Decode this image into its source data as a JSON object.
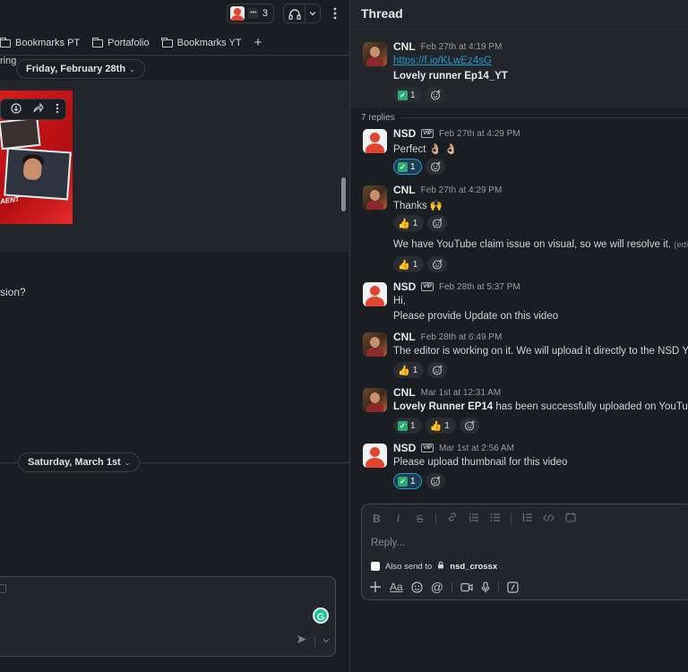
{
  "channel": {
    "member_count": "3",
    "bookmarks": [
      {
        "label": "Bookmarks PT"
      },
      {
        "label": "Portafolio"
      },
      {
        "label": "Bookmarks YT"
      }
    ],
    "partial_text_top": "ring",
    "date_divider_1": "Friday, February 28th",
    "partial_text_mid": "sion?",
    "date_divider_2": "Saturday, March 1st",
    "image_text": "AENT"
  },
  "thread": {
    "title": "Thread",
    "replies_label": "7 replies",
    "parent": {
      "author": "CNL",
      "time": "Feb 27th at 4:19 PM",
      "link": "https://f.io/KLwEz4sG",
      "text": "Lovely runner Ep14_YT",
      "reactions": [
        {
          "emoji": "check",
          "count": "1",
          "mine": false
        }
      ]
    },
    "messages": [
      {
        "author": "NSD",
        "vip": true,
        "time": "Feb 27th at 4:29 PM",
        "text": "Perfect 👌🏼 👌🏼",
        "reactions": [
          {
            "emoji": "check",
            "count": "1",
            "mine": true
          }
        ]
      },
      {
        "author": "CNL",
        "vip": false,
        "time": "Feb 27th at 4:29 PM",
        "text": "Thanks 🙌",
        "reactions": [
          {
            "emoji": "thumbs",
            "count": "1",
            "mine": false
          }
        ]
      },
      {
        "author": "",
        "vip": false,
        "time": "",
        "text": "We have YouTube claim issue on visual, so we will resolve it.",
        "edited": "(edited)",
        "reactions": [
          {
            "emoji": "thumbs",
            "count": "1",
            "mine": false
          }
        ]
      },
      {
        "author": "NSD",
        "vip": true,
        "time": "Feb 28th at 5:37 PM",
        "text": "Hi,",
        "text2": "Please provide Update on this video",
        "reactions": []
      },
      {
        "author": "CNL",
        "vip": false,
        "time": "Feb 28th at 6:49 PM",
        "text": "The editor is working on it. We will upload it directly to the NSD You",
        "reactions": [
          {
            "emoji": "thumbs",
            "count": "1",
            "mine": false
          }
        ]
      },
      {
        "author": "CNL",
        "vip": false,
        "time": "Mar 1st at 12:31 AM",
        "bold": "Lovely Runner EP14",
        "text": " has been successfully uploaded on YouTube as",
        "reactions": [
          {
            "emoji": "check",
            "count": "1",
            "mine": false
          },
          {
            "emoji": "thumbs",
            "count": "1",
            "mine": false
          }
        ]
      },
      {
        "author": "NSD",
        "vip": true,
        "time": "Mar 1st at 2:56 AM",
        "text": "Please upload thumbnail for this video",
        "reactions": [
          {
            "emoji": "check",
            "count": "1",
            "mine": true
          }
        ]
      }
    ],
    "composer": {
      "placeholder": "Reply...",
      "also_send": "Also send to",
      "channel": "nsd_crossx"
    }
  },
  "icons": {
    "vip_badge": "VIP",
    "thumbs": "👍",
    "check": "✓"
  }
}
